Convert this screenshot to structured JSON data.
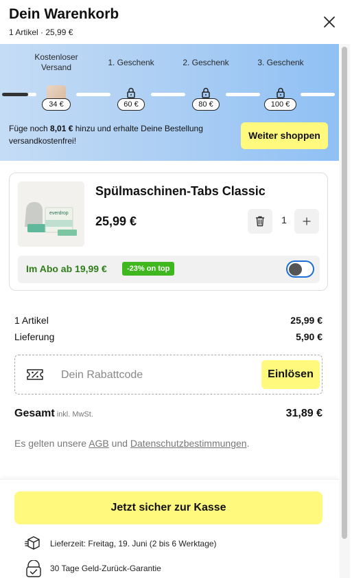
{
  "header": {
    "title": "Dein Warenkorb",
    "subtitle": "1 Artikel · 25,99 €",
    "close_icon": "close-icon"
  },
  "shipping": {
    "steps": [
      {
        "label": "Kostenloser Versand",
        "badge": "34 €",
        "state": "reached"
      },
      {
        "label": "1. Geschenk",
        "badge": "60 €",
        "state": "locked"
      },
      {
        "label": "2. Geschenk",
        "badge": "80 €",
        "state": "locked"
      },
      {
        "label": "3. Geschenk",
        "badge": "100 €",
        "state": "locked"
      }
    ],
    "message_prefix": "Füge noch ",
    "message_amount": "8,01 €",
    "message_suffix": " hinzu und erhalte Deine Bestellung versandkostenfrei!",
    "continue_label": "Weiter shoppen"
  },
  "product": {
    "name": "Spülmaschinen-Tabs Classic",
    "price": "25,99 €",
    "quantity": "1",
    "brand_on_box": "everdrop",
    "abo_label": "Im Abo ab 19,99 €",
    "abo_badge": "-23% on top",
    "abo_enabled": false
  },
  "summary": {
    "items_label": "1 Artikel",
    "items_value": "25,99 €",
    "delivery_label": "Lieferung",
    "delivery_value": "5,90 €",
    "coupon_placeholder": "Dein Rabattcode",
    "redeem_label": "Einlösen",
    "total_label": "Gesamt",
    "total_note": "inkl. MwSt.",
    "total_value": "31,89 €"
  },
  "legal": {
    "prefix": "Es gelten unsere ",
    "agb": "AGB",
    "middle": " und ",
    "privacy": "Datenschutzbestimmungen",
    "suffix": "."
  },
  "footer": {
    "checkout_label": "Jetzt sicher zur Kasse",
    "delivery_info": "Lieferzeit: Freitag, 19. Juni (2 bis 6 Werktage)",
    "guarantee_info": "30 Tage Geld-Zurück-Garantie"
  },
  "colors": {
    "accent_yellow": "#fff97d",
    "abo_green": "#2e7d19",
    "badge_green": "#3fb81f",
    "toggle_blue": "#1f6ed4",
    "banner_blue": "#a9cdf4"
  }
}
